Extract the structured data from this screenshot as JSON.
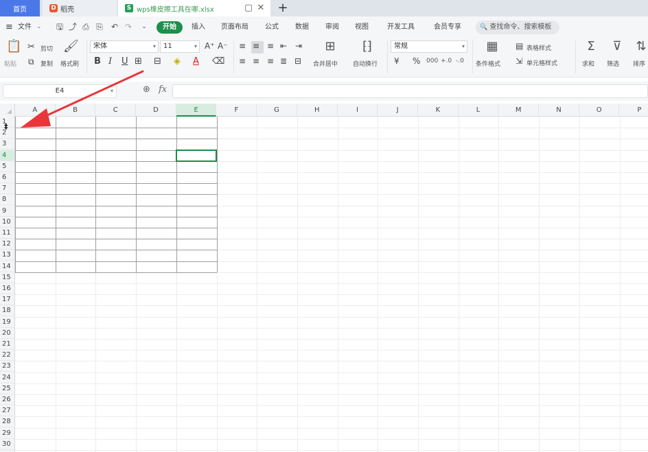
{
  "titlebar": {
    "home_tab": "首页",
    "docer_tab": "稻壳",
    "docer_logo": "D",
    "file_tab": "wps橡皮擦工具在哪.xlsx",
    "file_logo": "S",
    "window_ctl": "▢",
    "close": "✕",
    "new_tab": "+"
  },
  "menu": {
    "hamburger": "≡",
    "file": "文件",
    "file_caret": "⌄",
    "start": "开始",
    "items": [
      "插入",
      "页面布局",
      "公式",
      "数据",
      "审阅",
      "视图",
      "开发工具",
      "会员专享"
    ],
    "search": "查找命令、搜索模板",
    "search_icon": "🔍"
  },
  "ribbon": {
    "paste": "粘贴",
    "cut": "剪切",
    "copy": "复制",
    "format_painter": "格式刷",
    "font_name": "宋体",
    "font_size": "11",
    "bold": "B",
    "italic": "I",
    "underline": "U",
    "grow_font": "A⁺",
    "shrink_font": "A⁻",
    "merge_center": "合并居中",
    "wrap_text": "自动换行",
    "number_format": "常规",
    "currency": "¥",
    "percent": "%",
    "thousands": "000",
    "inc_decimal": "+.0",
    "dec_decimal": "-.0",
    "conditional_format": "条件格式",
    "table_style": "表格样式",
    "cell_style": "单元格样式",
    "sum": "求和",
    "filter": "筛选",
    "sort": "排序"
  },
  "formula_bar": {
    "name_box": "E4",
    "fx": "fx",
    "zoom_icon": "⊕",
    "formula": ""
  },
  "sheet": {
    "columns": [
      "A",
      "B",
      "C",
      "D",
      "E",
      "F",
      "G",
      "H",
      "I",
      "J",
      "K",
      "L",
      "M",
      "N",
      "O",
      "P"
    ],
    "rows": [
      "1",
      "2",
      "3",
      "4",
      "5",
      "6",
      "7",
      "8",
      "9",
      "10",
      "11",
      "12",
      "13",
      "14",
      "15",
      "16",
      "17",
      "18",
      "19",
      "20",
      "21",
      "22",
      "23",
      "24",
      "25",
      "26",
      "27",
      "28",
      "29",
      "30"
    ],
    "selected_column": "E",
    "selected_row": "4",
    "resize_cursor": "‡"
  },
  "colors": {
    "accent": "#1f8a49",
    "home_tab": "#4a78e8",
    "annotation_arrow": "#e8363a"
  }
}
